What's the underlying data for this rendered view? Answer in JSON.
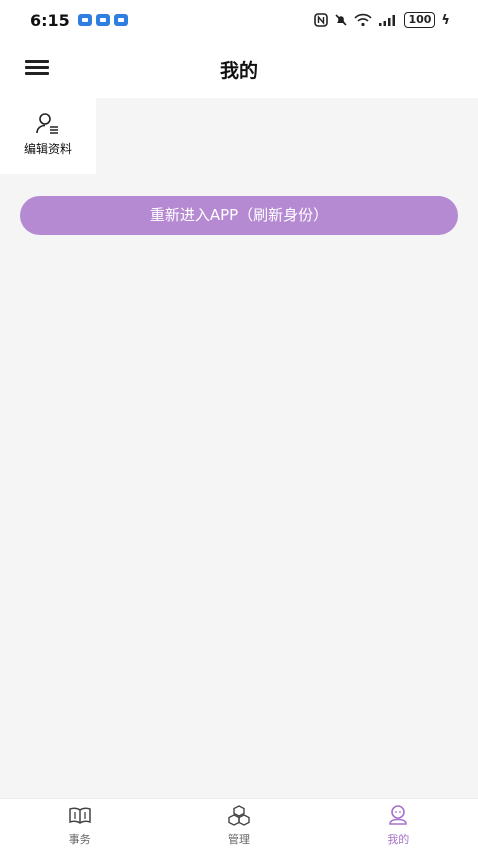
{
  "status_bar": {
    "time": "6:15",
    "battery": "100",
    "battery_suffix": "ϟ"
  },
  "header": {
    "title": "我的"
  },
  "profile": {
    "edit_label": "编辑资料"
  },
  "actions": {
    "reenter_label": "重新进入APP（刷新身份）"
  },
  "bottom_nav": {
    "items": [
      {
        "label": "事务",
        "icon": "book-icon"
      },
      {
        "label": "管理",
        "icon": "cubes-icon"
      },
      {
        "label": "我的",
        "icon": "user-icon"
      }
    ],
    "active_index": 2
  },
  "colors": {
    "accent": "#b68ad3",
    "active_nav": "#a673c9",
    "background": "#f5f5f5"
  }
}
